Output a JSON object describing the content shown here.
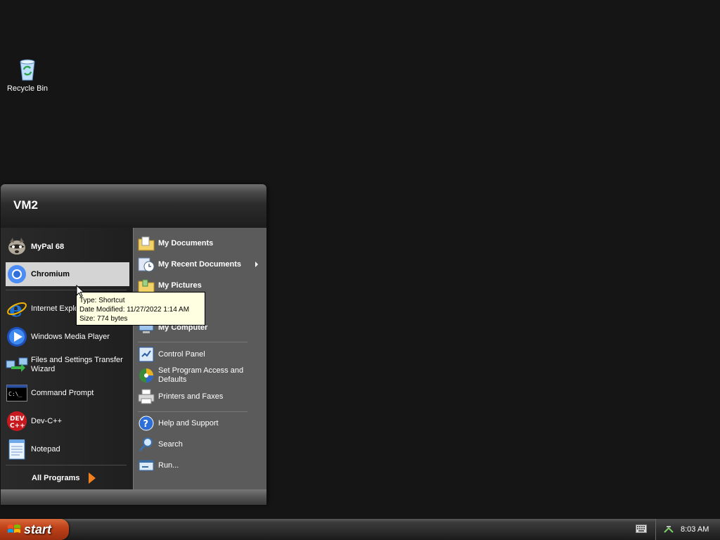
{
  "desktop": {
    "icons": [
      {
        "label": "Recycle Bin",
        "icon": "recycle-bin-icon"
      }
    ]
  },
  "start_menu": {
    "user": "VM2",
    "pinned": [
      {
        "label": "MyPal 68",
        "icon": "raccoon-icon"
      },
      {
        "label": "Chromium",
        "icon": "chromium-icon"
      }
    ],
    "recent": [
      {
        "label": "Internet Explorer",
        "icon": "internet-explorer-icon"
      },
      {
        "label": "Windows Media Player",
        "icon": "media-player-icon"
      },
      {
        "label": "Files and Settings Transfer Wizard",
        "icon": "transfer-wizard-icon"
      },
      {
        "label": "Command Prompt",
        "icon": "command-prompt-icon"
      },
      {
        "label": "Dev-C++",
        "icon": "devcpp-icon"
      },
      {
        "label": "Notepad",
        "icon": "notepad-icon"
      }
    ],
    "all_programs": "All Programs",
    "right": [
      {
        "label": "My Documents",
        "icon": "folder-documents-icon"
      },
      {
        "label": "My Recent Documents",
        "icon": "recent-documents-icon"
      },
      {
        "label": "My Pictures",
        "icon": "folder-pictures-icon"
      },
      {
        "label": "My Computer",
        "icon": "computer-icon"
      },
      {
        "label": "Control Panel",
        "icon": "control-panel-icon"
      },
      {
        "label": "Set Program Access and Defaults",
        "icon": "program-defaults-icon"
      },
      {
        "label": "Printers and Faxes",
        "icon": "printer-icon"
      },
      {
        "label": "Help and Support",
        "icon": "help-icon"
      },
      {
        "label": "Search",
        "icon": "search-icon"
      },
      {
        "label": "Run...",
        "icon": "run-icon"
      }
    ]
  },
  "tooltip": {
    "type": "Type: Shortcut",
    "modified": "Date Modified: 11/27/2022 1:14 AM",
    "size": "Size: 774 bytes"
  },
  "taskbar": {
    "start_label": "start",
    "clock": "8:03 AM"
  },
  "colors": {
    "start_button": "#c0431a",
    "highlight": "#d4d4d4",
    "tooltip_bg": "#ffffe1"
  }
}
